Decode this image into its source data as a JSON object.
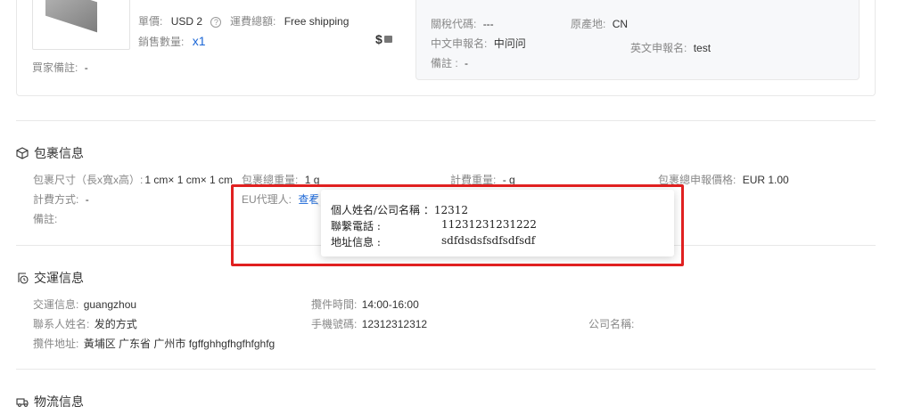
{
  "product": {
    "unit_price_label": "單價:",
    "unit_price_value": "USD 2",
    "help_icon_glyph": "?",
    "shipping_label": "運費總額:",
    "shipping_value": "Free shipping",
    "sale_qty_label": "銷售數量:",
    "sale_qty_value": "x1",
    "price_icon_glyph": "$",
    "buyer_note_label": "買家備註:",
    "buyer_note_value": "-"
  },
  "customs": {
    "hs_code_label": "關稅代碼:",
    "hs_code_value": "---",
    "origin_label": "原產地:",
    "origin_value": "CN",
    "cn_name_label": "中文申報名:",
    "cn_name_value": "中问问",
    "en_name_label": "英文申報名:",
    "en_name_value": "test",
    "note_label": "備註 :",
    "note_value": "-"
  },
  "package": {
    "title": "包裹信息",
    "size_label": "包裹尺寸（長x寬x高）:",
    "size_value": "1 cm× 1 cm× 1 cm",
    "total_weight_label": "包裹總重量:",
    "total_weight_value": "1 g",
    "charge_weight_label": "計費重量:",
    "charge_weight_value": "- g",
    "declared_price_label": "包裹總申報價格:",
    "declared_price_value": "EUR 1.00",
    "charge_method_label": "計費方式:",
    "charge_method_value": "-",
    "eu_agent_label": "EU代理人:",
    "eu_agent_link": "查看",
    "note_label": "備註:",
    "note_value": ""
  },
  "popover": {
    "name_label": "個人姓名/公司名稱 ：",
    "name_value": "12312",
    "phone_label": "聯繫電話 :",
    "phone_value": "11231231231222",
    "address_label": "地址信息 :",
    "address_value": "sdfdsdsfsdfsdfsdf"
  },
  "handover": {
    "title": "交運信息",
    "info_label": "交運信息:",
    "info_value": "guangzhou",
    "pickup_time_label": "攬件時間:",
    "pickup_time_value": "14:00-16:00",
    "contact_label": "聯系人姓名:",
    "contact_value": "发的方式",
    "phone_label": "手機號碼:",
    "phone_value": "12312312312",
    "company_label": "公司名稱:",
    "company_value": "",
    "address_label": "攬件地址:",
    "address_value": "黃埔区 广东省 广州市 fgffghhgfhgfhfghfg"
  },
  "logistics": {
    "title": "物流信息"
  },
  "colors": {
    "link": "#1a66d6",
    "highlight": "#e02020",
    "border": "#e8e8e8"
  }
}
